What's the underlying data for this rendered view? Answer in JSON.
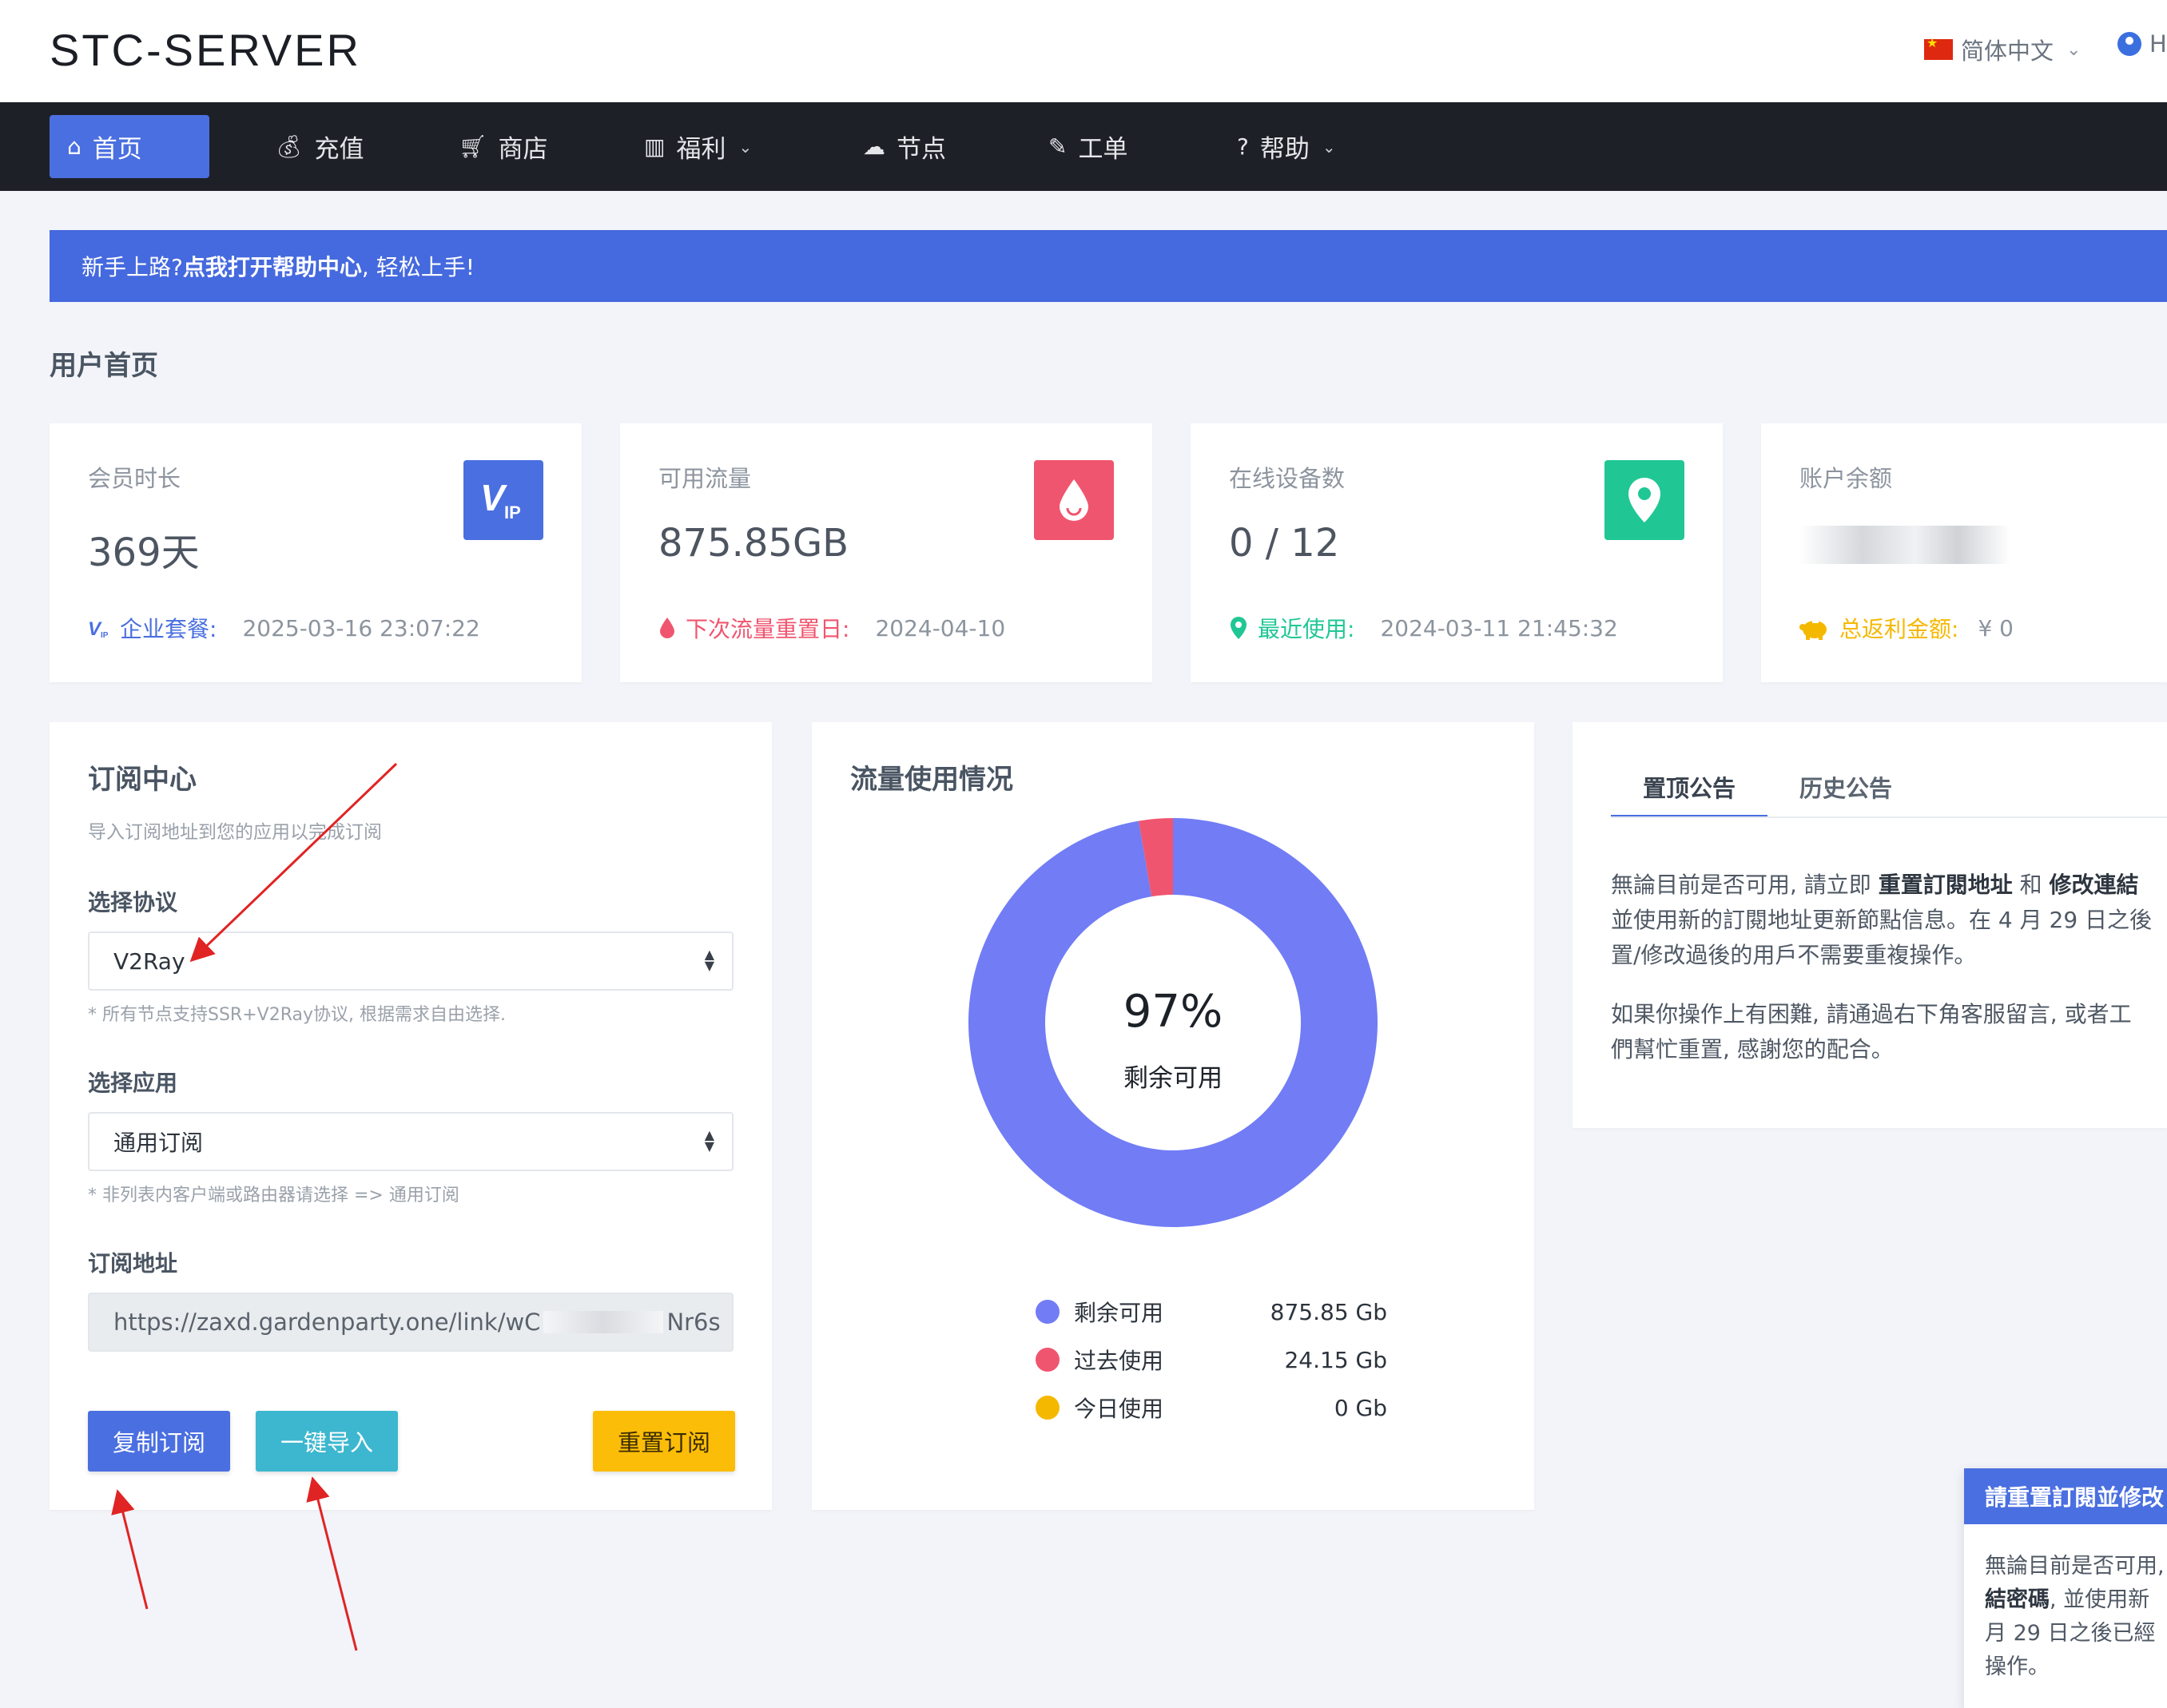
{
  "header": {
    "logo": "STC-SERVER",
    "language": "简体中文",
    "user_initial": "H"
  },
  "nav": {
    "items": [
      {
        "icon": "home-icon",
        "label": "首页",
        "active": true
      },
      {
        "icon": "moneybag-icon",
        "label": "充值"
      },
      {
        "icon": "cart-icon",
        "label": "商店"
      },
      {
        "icon": "gift-icon",
        "label": "福利",
        "dropdown": true
      },
      {
        "icon": "cloud-icon",
        "label": "节点"
      },
      {
        "icon": "edit-icon",
        "label": "工单"
      },
      {
        "icon": "question-icon",
        "label": "帮助",
        "dropdown": true
      }
    ]
  },
  "banner": {
    "prefix": "新手上路? ",
    "link": "点我打开帮助中心",
    "suffix": ", 轻松上手!"
  },
  "page_title": "用户首页",
  "stats": [
    {
      "label": "会员时长",
      "value": "369天",
      "badge": "vip-badge-icon",
      "foot_label": "企业套餐:",
      "foot_value": "2025-03-16 23:07:22",
      "color": "#4a6fe0"
    },
    {
      "label": "可用流量",
      "value": "875.85GB",
      "badge": "water-drop-icon",
      "foot_label": "下次流量重置日:",
      "foot_value": "2024-04-10",
      "color": "#f0556f"
    },
    {
      "label": "在线设备数",
      "value": "0 / 12",
      "badge": "map-pin-icon",
      "foot_label": "最近使用:",
      "foot_value": "2024-03-11 21:45:32",
      "color": "#20c795"
    },
    {
      "label": "账户余额",
      "value": "",
      "badge": "",
      "foot_label": "总返利金额:",
      "foot_value": "¥ 0",
      "color": "#f5b800"
    }
  ],
  "subscription": {
    "title": "订阅中心",
    "description": "导入订阅地址到您的应用以完成订阅",
    "protocol_label": "选择协议",
    "protocol_value": "V2Ray",
    "protocol_hint": "* 所有节点支持SSR+V2Ray协议, 根据需求自由选择.",
    "app_label": "选择应用",
    "app_value": "通用订阅",
    "app_hint": "* 非列表内客户端或路由器请选择 => 通用订阅",
    "url_label": "订阅地址",
    "url_start": "https://zaxd.gardenparty.one/link/wC",
    "url_end": "Nr6s",
    "copy_button": "复制订阅",
    "import_button": "一键导入",
    "reset_button": "重置订阅"
  },
  "traffic": {
    "title": "流量使用情况",
    "percent": "97%",
    "percent_label": "剩余可用",
    "legend": [
      {
        "label": "剩余可用",
        "value": "875.85 Gb",
        "color": "#717cf5"
      },
      {
        "label": "过去使用",
        "value": "24.15 Gb",
        "color": "#f0556f"
      },
      {
        "label": "今日使用",
        "value": "0 Gb",
        "color": "#f5b800"
      }
    ]
  },
  "chart_data": {
    "type": "pie",
    "categories": [
      "剩余可用",
      "过去使用",
      "今日使用"
    ],
    "values": [
      875.85,
      24.15,
      0
    ],
    "unit": "Gb",
    "colors": [
      "#717cf5",
      "#f0556f",
      "#f5b800"
    ],
    "donut": true
  },
  "notice": {
    "tab_pinned": "置顶公告",
    "tab_history": "历史公告",
    "p1_line1_a": "無論目前是否可用, 請立即 ",
    "p1_line1_b": "重置訂閱地址",
    "p1_line1_c": " 和 ",
    "p1_line1_d": "修改連結",
    "p1_line2": "並使用新的訂閱地址更新節點信息。在 4 月 29 日之後",
    "p1_line3": "置/修改過後的用戶不需要重複操作。",
    "p2_line1": "如果你操作上有困難, 請通過右下角客服留言, 或者工",
    "p2_line2": "們幫忙重置, 感謝您的配合。"
  },
  "popup": {
    "title": "請重置訂閱並修改",
    "line1": "無論目前是否可用,",
    "line2_b": "結密碼",
    "line2_c": ", 並使用新",
    "line3": "月 29 日之後已經",
    "line4": "操作。"
  }
}
